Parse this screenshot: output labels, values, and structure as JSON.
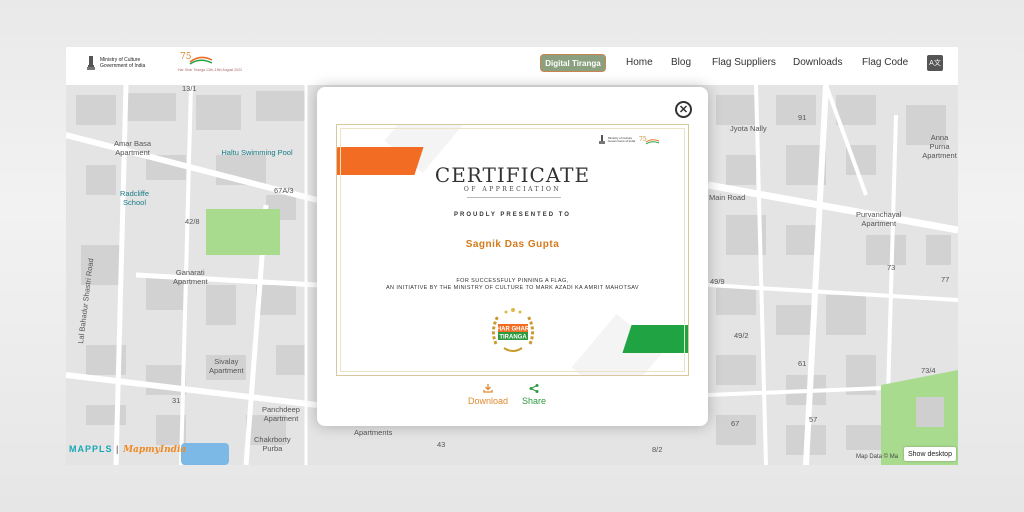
{
  "header": {
    "ministry_line1": "Ministry of Culture",
    "ministry_line2": "Government of India",
    "amrit_caption": "Har Ghar Tiranga 13th–15th August 2022",
    "digital_tiranga_label": "Digital Tiranga",
    "menu": [
      {
        "label": "Home"
      },
      {
        "label": "Blog"
      },
      {
        "label": "Flag Suppliers"
      },
      {
        "label": "Downloads"
      },
      {
        "label": "Flag Code"
      }
    ],
    "language_icon": "translate-icon"
  },
  "map": {
    "labels": [
      {
        "text": "13/1"
      },
      {
        "text": "Amar Basa\nApartment"
      },
      {
        "text": "Haltu Swimming Pool"
      },
      {
        "text": "Radcliffe\nSchool"
      },
      {
        "text": "67A/3"
      },
      {
        "text": "42/8"
      },
      {
        "text": "Ganarati\nApartment"
      },
      {
        "text": "Lal Bahadur Shastri Road"
      },
      {
        "text": "Sivalay\nApartment"
      },
      {
        "text": "31"
      },
      {
        "text": "Panchdeep\nApartment"
      },
      {
        "text": "Chakrborty\nPurba"
      },
      {
        "text": "Apartments"
      },
      {
        "text": "43"
      },
      {
        "text": "8/2"
      },
      {
        "text": "Jyota Nally"
      },
      {
        "text": "91"
      },
      {
        "text": "Anna Purna\nApartment"
      },
      {
        "text": "Main Road"
      },
      {
        "text": "Purvanchayal\nApartment"
      },
      {
        "text": "73"
      },
      {
        "text": "77"
      },
      {
        "text": "49/9"
      },
      {
        "text": "49/2"
      },
      {
        "text": "61"
      },
      {
        "text": "73/4"
      },
      {
        "text": "67"
      },
      {
        "text": "57"
      }
    ],
    "brand_mappls": "MAPPLS",
    "brand_mapmyindia": "MapmyIndia",
    "attribution": "Map Data © Ma",
    "show_desktop_label": "Show desktop"
  },
  "modal": {
    "close_icon": "close-icon",
    "certificate": {
      "logo_line1": "Ministry of Culture",
      "logo_line2": "Government of India",
      "title": "CERTIFICATE",
      "subtitle": "OF APPRECIATION",
      "presented_to": "PROUDLY PRESENTED TO",
      "recipient_name": "Sagnik Das Gupta",
      "description_line1": "FOR SUCCESSFULY PINNING A FLAG,",
      "description_line2": "AN INITIATIVE BY THE MINISTRY OF CULTURE TO MARK AZADI KA AMRIT MAHOTSAV",
      "badge_line1": "HAR GHAR",
      "badge_line2": "TIRANGA"
    },
    "download_label": "Download",
    "share_label": "Share"
  },
  "colors": {
    "saffron": "#f26d23",
    "green": "#1fa343",
    "download": "#e0892e",
    "share": "#2e9a3f",
    "map_bg": "#e4e4e4"
  }
}
